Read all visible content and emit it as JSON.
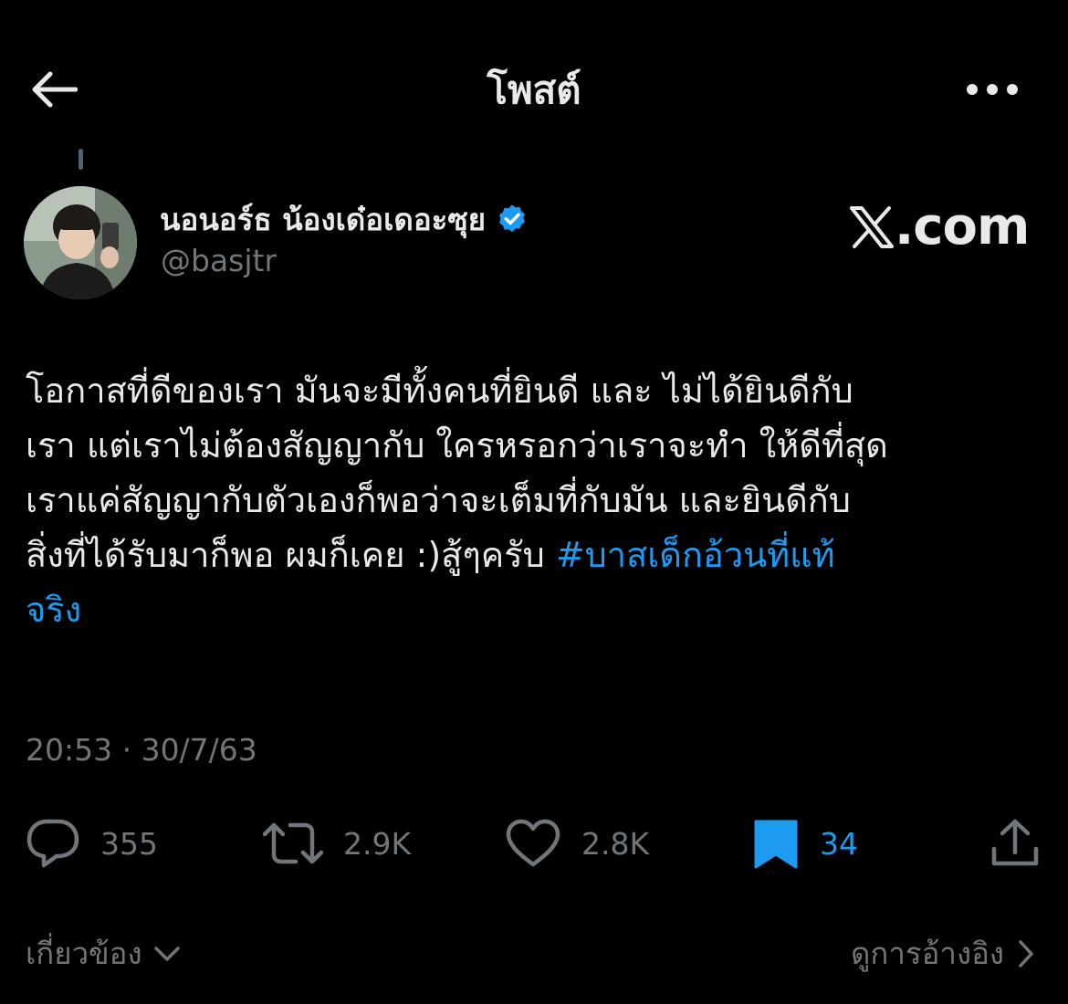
{
  "header": {
    "title": "โพสต์",
    "back_icon": "arrow-left-icon",
    "more_icon": "more-horizontal-icon"
  },
  "author": {
    "display_name": "นอนอร์ธ น้องเด๋อเดอะซุย",
    "handle": "@basjtr",
    "verified_icon": "verified-badge-icon",
    "verified_color": "#1d9bf0"
  },
  "watermark": {
    "x_letter": "X",
    "suffix": ".com"
  },
  "tweet": {
    "lines": [
      "โอกาสที่ดีของเรา มันจะมีทั้งคนที่ยินดี และ ไม่ได้ยินดีกับ",
      "เรา แต่เราไม่ต้องสัญญากับ ใครหรอกว่าเราจะทำ ให้ดีที่สุด",
      "เราแค่สัญญากับตัวเองก็พอว่าจะเต็มที่กับมัน และยินดีกับ",
      "สิ่งที่ได้รับมาก็พอ ผมก็เคย :)สู้ๆครับ "
    ],
    "hashtag_part1": "#บาสเด็กอ้วนที่แท้",
    "hashtag_part2": "จริง",
    "link_color": "#1d9bf0"
  },
  "timestamp": "20:53 · 30/7/63",
  "actions": {
    "replies": "355",
    "retweets": "2.9K",
    "likes": "2.8K",
    "bookmarks": "34"
  },
  "footer": {
    "related_label": "เกี่ยวข้อง",
    "quotes_label": "ดูการอ้างอิง"
  },
  "colors": {
    "background": "#000000",
    "text": "#e7e9ea",
    "secondary": "#71767b",
    "accent": "#1d9bf0"
  }
}
